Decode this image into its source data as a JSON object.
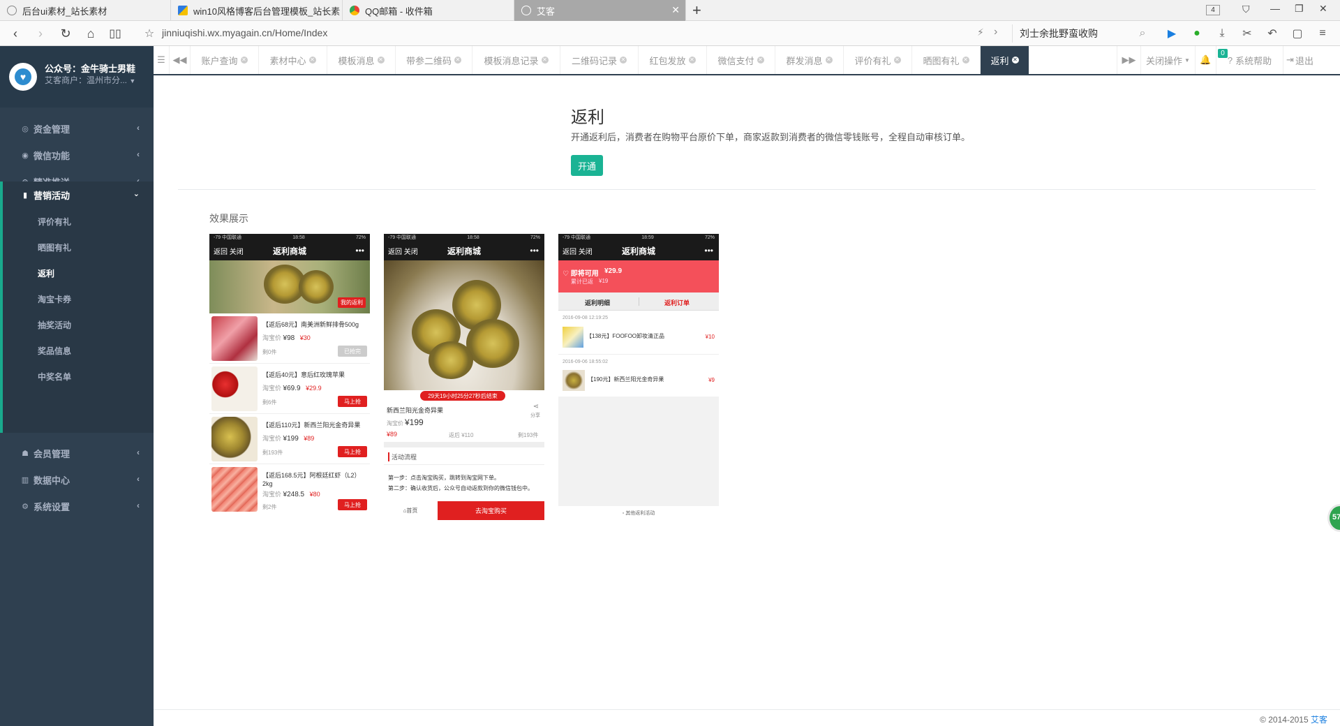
{
  "browser": {
    "tabs": [
      {
        "title": "后台ui素材_站长素材"
      },
      {
        "title": "win10风格博客后台管理模板_站长素"
      },
      {
        "title": "QQ邮箱 - 收件箱"
      },
      {
        "title": "艾客"
      }
    ],
    "tab_count": "4",
    "url": "jinniuqishi.wx.myagain.cn/Home/Index",
    "search_text": "刘士余批野蛮收购"
  },
  "sidebar": {
    "account": "公众号：金牛骑士男鞋",
    "shop": "艾客商户：温州市分...",
    "menu": [
      {
        "label": "资金管理",
        "icon": "money-icon"
      },
      {
        "label": "微信功能",
        "icon": "wechat-icon"
      },
      {
        "label": "精准推送",
        "icon": "target-icon"
      },
      {
        "label": "营销活动",
        "icon": "bookmark-icon"
      }
    ],
    "submenu": [
      "评价有礼",
      "晒图有礼",
      "返利",
      "淘宝卡券",
      "抽奖活动",
      "奖品信息",
      "中奖名单"
    ],
    "menu_bottom": [
      {
        "label": "会员管理",
        "icon": "users-icon"
      },
      {
        "label": "数据中心",
        "icon": "chart-icon"
      },
      {
        "label": "系统设置",
        "icon": "gear-icon"
      }
    ]
  },
  "content_tabs": [
    "账户查询",
    "素材中心",
    "模板消息",
    "带参二维码",
    "模板消息记录",
    "二维码记录",
    "红包发放",
    "微信支付",
    "群发消息",
    "评价有礼",
    "晒图有礼",
    "返利"
  ],
  "toolbar": {
    "close_ops": "关闭操作",
    "notice_count": "0",
    "help": "系统帮助",
    "logout": "退出"
  },
  "main": {
    "title": "返利",
    "description": "开通返利后，消费者在购物平台原价下单，商家返款到消费者的微信零钱账号，全程自动审核订单。",
    "open_button": "开通",
    "effect_title": "效果展示"
  },
  "phone": {
    "status_left": "-79 中国联通",
    "time1": "18:58",
    "time3": "18:59",
    "battery": "72%",
    "back": "返回  关闭",
    "nav_title": "返利商城",
    "my_rebate": "我的返利"
  },
  "phone1": {
    "products": [
      {
        "title": "【返后68元】南美洲新鲜排骨500g",
        "tb_label": "淘宝价",
        "tb_price": "¥98",
        "rebate": "¥30",
        "sold": "剩0件",
        "button": "已抢完"
      },
      {
        "title": "【返后40元】意后红玫瑰苹果",
        "tb_label": "淘宝价",
        "tb_price": "¥69.9",
        "rebate": "¥29.9",
        "sold": "剩6件",
        "button": "马上抢"
      },
      {
        "title": "【返后110元】新西兰阳光金奇异果",
        "tb_label": "淘宝价",
        "tb_price": "¥199",
        "rebate": "¥89",
        "sold": "剩193件",
        "button": "马上抢"
      },
      {
        "title": "【返后168.5元】阿根廷红虾（L2）2kg",
        "tb_label": "淘宝价",
        "tb_price": "¥248.5",
        "rebate": "¥80",
        "sold": "剩2件",
        "button": "马上抢"
      }
    ]
  },
  "phone2": {
    "countdown": "29天19小时25分27秒后结束",
    "name": "新西兰阳光金奇异果",
    "share": "分享",
    "tb_label": "淘宝价",
    "price": "¥199",
    "rebate": "¥89",
    "after": "返后 ¥110",
    "sold": "剩193件",
    "flow_title": "活动流程",
    "step1": "第一步：点击淘宝购买，跳转到淘宝网下单。",
    "step2": "第二步：确认收货后，公众号自动返款到你的微信钱包中。",
    "home": "首页",
    "buy": "去淘宝购买"
  },
  "phone3": {
    "available_label": "即将可用",
    "available": "¥29.9",
    "total_label": "累计已返",
    "total": "¥19",
    "tab1": "返利明细",
    "tab2": "返利订单",
    "orders": [
      {
        "date": "2016-09-08 12:19:25",
        "title": "【138元】FOOFOO卸妆清正品",
        "amount": "¥10"
      },
      {
        "date": "2016-09-06 18:55:02",
        "title": "【190元】新西兰阳光金奇异果",
        "amount": "¥9"
      }
    ],
    "other": "其他返利活动"
  },
  "footer": {
    "copyright": "© 2014-2015 ",
    "brand": "艾客"
  },
  "float_badge": "57"
}
